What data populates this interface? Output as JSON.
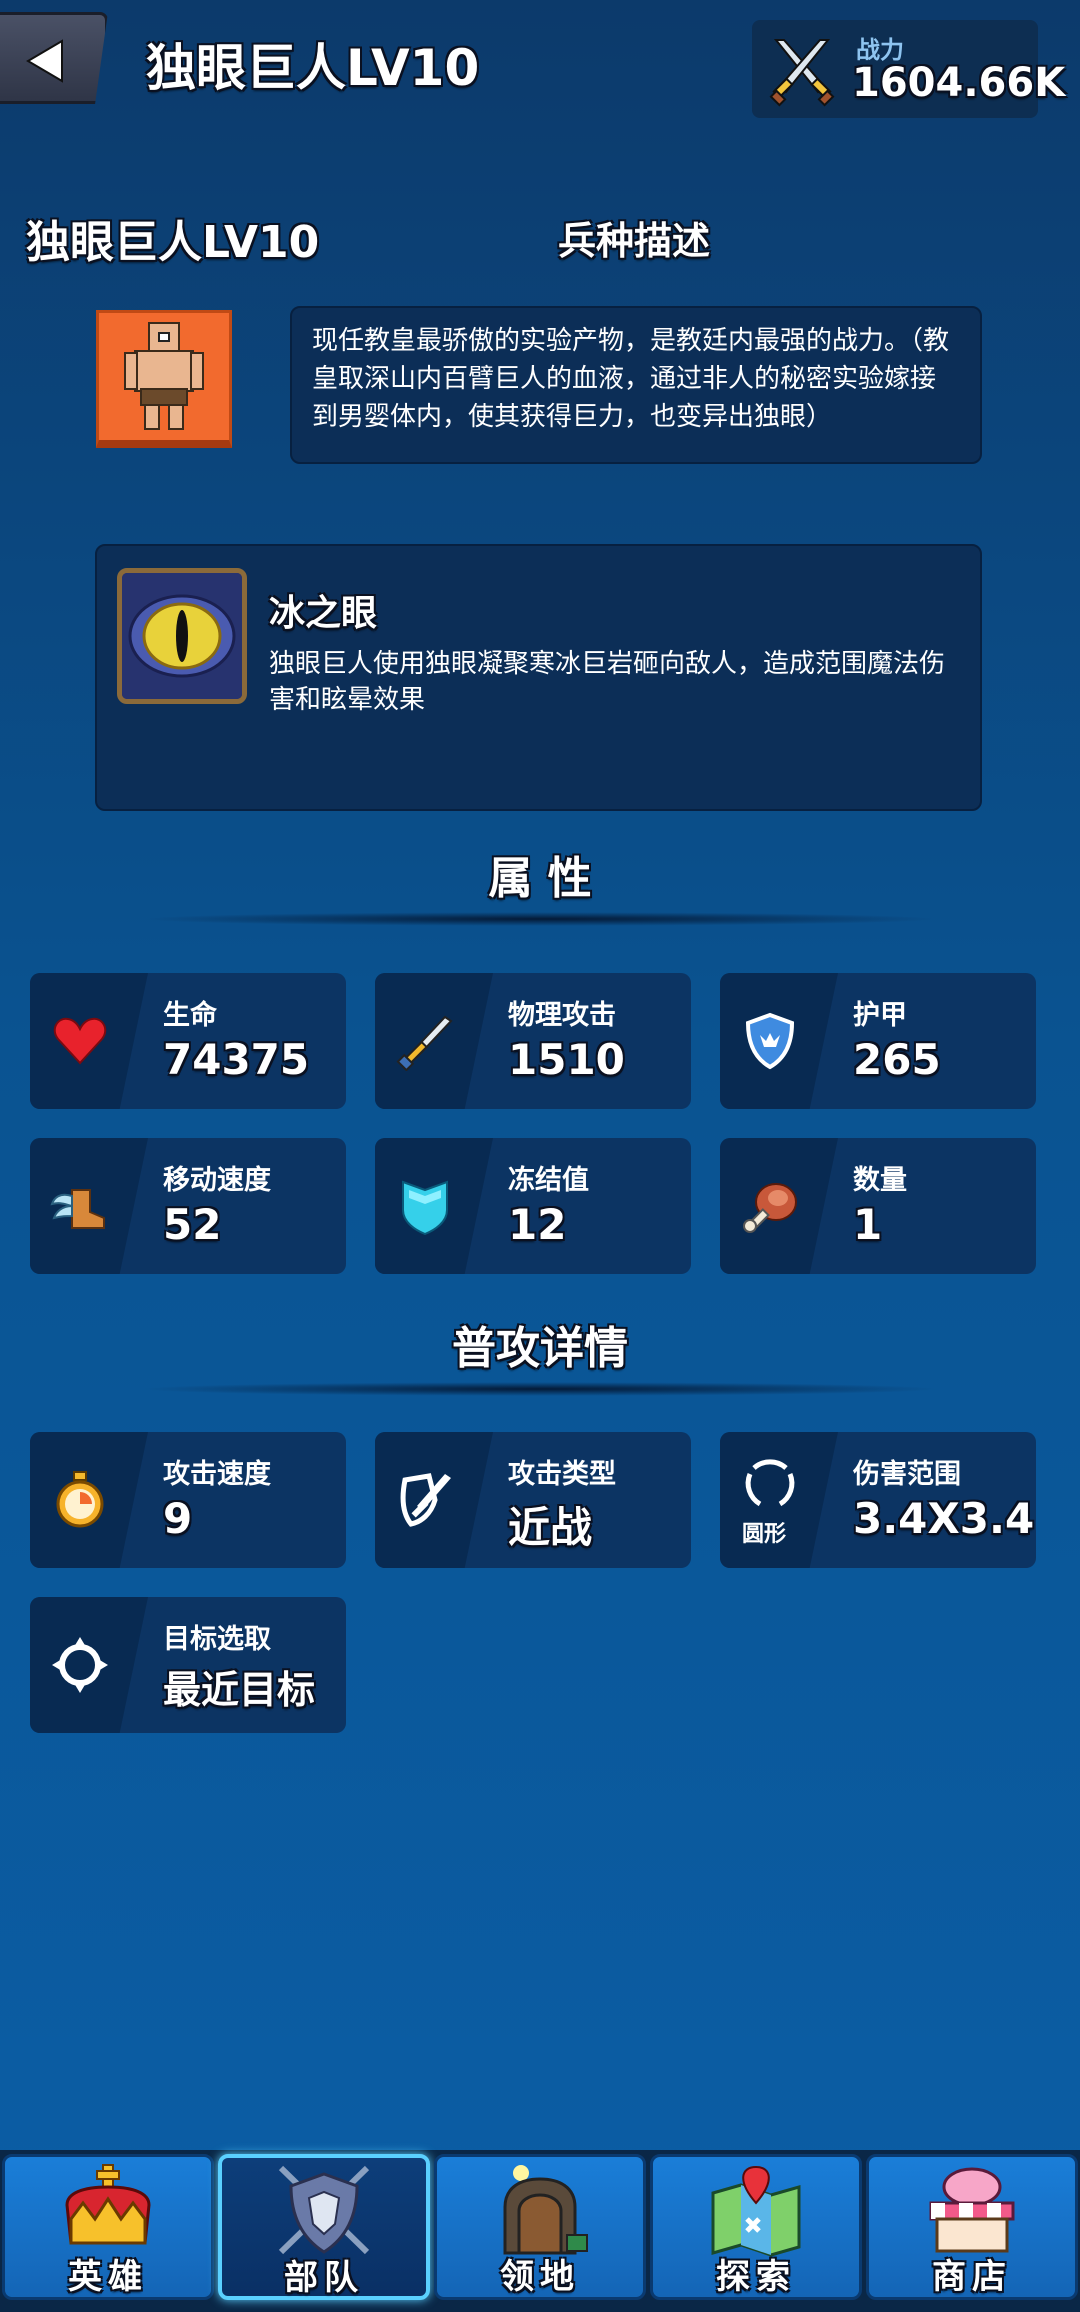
{
  "header": {
    "title": "独眼巨人LV10",
    "power_label": "战力",
    "power_value": "1604.66K"
  },
  "unit": {
    "name": "独眼巨人LV10",
    "desc_title": "兵种描述",
    "description": "现任教皇最骄傲的实验产物，是教廷内最强的战力。（教皇取深山内百臂巨人的血液，通过非人的秘密实验嫁接到男婴体内，使其获得巨力，也变异出独眼）"
  },
  "skill": {
    "name": "冰之眼",
    "description": "独眼巨人使用独眼凝聚寒冰巨岩砸向敌人，造成范围魔法伤害和眩晕效果"
  },
  "attributes": {
    "title": "属  性",
    "items": [
      {
        "label": "生命",
        "value": "74375",
        "icon": "heart-icon"
      },
      {
        "label": "物理攻击",
        "value": "1510",
        "icon": "sword-icon"
      },
      {
        "label": "护甲",
        "value": "265",
        "icon": "shield-crown-icon"
      },
      {
        "label": "移动速度",
        "value": "52",
        "icon": "winged-boot-icon"
      },
      {
        "label": "冻结值",
        "value": "12",
        "icon": "ice-shield-icon"
      },
      {
        "label": "数量",
        "value": "1",
        "icon": "meat-icon"
      }
    ]
  },
  "attack": {
    "title": "普攻详情",
    "items": [
      {
        "label": "攻击速度",
        "value": "9",
        "icon": "stopwatch-icon"
      },
      {
        "label": "攻击类型",
        "value": "近战",
        "icon": "melee-shield-icon"
      },
      {
        "label": "伤害范围",
        "value": "3.4X3.4",
        "icon": "circle-range-icon",
        "icon_caption": "圆形"
      },
      {
        "label": "目标选取",
        "value": "最近目标",
        "icon": "crosshair-icon"
      }
    ]
  },
  "nav": {
    "tabs": [
      {
        "label": "英雄",
        "icon": "crown-icon"
      },
      {
        "label": "部队",
        "icon": "wolf-shield-icon",
        "active": true
      },
      {
        "label": "领地",
        "icon": "castle-gate-icon"
      },
      {
        "label": "探索",
        "icon": "map-icon"
      },
      {
        "label": "商店",
        "icon": "shop-icon"
      }
    ]
  },
  "colors": {
    "background": "#0a5391",
    "card": "#0c3463",
    "portrait": "#f26a2e",
    "active_tab_border": "#5ad0ff"
  }
}
